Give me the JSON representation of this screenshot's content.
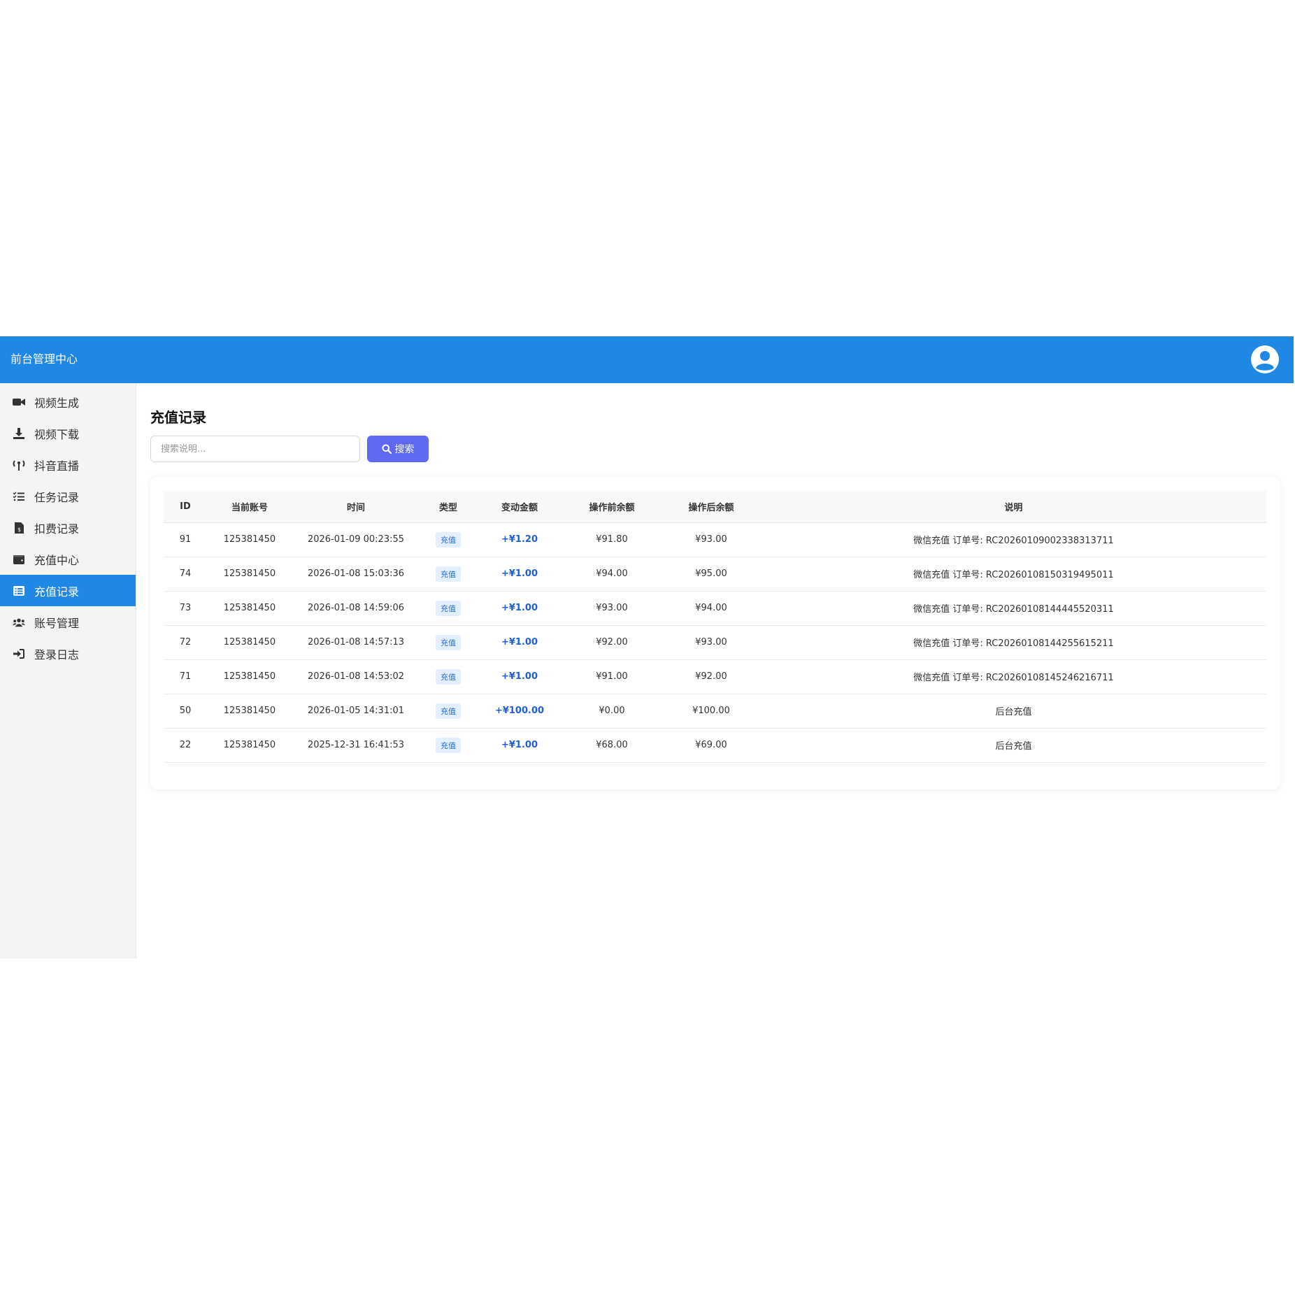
{
  "header": {
    "title": "前台管理中心",
    "avatar_icon": "user-circle-icon"
  },
  "sidebar": {
    "items": [
      {
        "label": "视频生成",
        "icon": "video-camera-icon",
        "active": false
      },
      {
        "label": "视频下载",
        "icon": "download-icon",
        "active": false
      },
      {
        "label": "抖音直播",
        "icon": "broadcast-tower-icon",
        "active": false
      },
      {
        "label": "任务记录",
        "icon": "task-list-icon",
        "active": false
      },
      {
        "label": "扣费记录",
        "icon": "invoice-dollar-icon",
        "active": false
      },
      {
        "label": "充值中心",
        "icon": "wallet-icon",
        "active": false
      },
      {
        "label": "充值记录",
        "icon": "list-alt-icon",
        "active": true
      },
      {
        "label": "账号管理",
        "icon": "users-icon",
        "active": false
      },
      {
        "label": "登录日志",
        "icon": "sign-in-icon",
        "active": false
      }
    ]
  },
  "main": {
    "title": "充值记录",
    "search": {
      "placeholder": "搜索说明...",
      "value": "",
      "button_label": "搜索"
    },
    "table": {
      "columns": [
        "ID",
        "当前账号",
        "时间",
        "类型",
        "变动金额",
        "操作前余额",
        "操作后余额",
        "说明"
      ],
      "rows": [
        [
          "91",
          "125381450",
          "2026-01-09 00:23:55",
          "充值",
          "+¥1.20",
          "¥91.80",
          "¥93.00",
          "微信充值 订单号: RC20260109002338313711"
        ],
        [
          "74",
          "125381450",
          "2026-01-08 15:03:36",
          "充值",
          "+¥1.00",
          "¥94.00",
          "¥95.00",
          "微信充值 订单号: RC20260108150319495011"
        ],
        [
          "73",
          "125381450",
          "2026-01-08 14:59:06",
          "充值",
          "+¥1.00",
          "¥93.00",
          "¥94.00",
          "微信充值 订单号: RC20260108144445520311"
        ],
        [
          "72",
          "125381450",
          "2026-01-08 14:57:13",
          "充值",
          "+¥1.00",
          "¥92.00",
          "¥93.00",
          "微信充值 订单号: RC20260108144255615211"
        ],
        [
          "71",
          "125381450",
          "2026-01-08 14:53:02",
          "充值",
          "+¥1.00",
          "¥91.00",
          "¥92.00",
          "微信充值 订单号: RC20260108145246216711"
        ],
        [
          "50",
          "125381450",
          "2026-01-05 14:31:01",
          "充值",
          "+¥100.00",
          "¥0.00",
          "¥100.00",
          "后台充值"
        ],
        [
          "22",
          "125381450",
          "2025-12-31 16:41:53",
          "充值",
          "+¥1.00",
          "¥68.00",
          "¥69.00",
          "后台充值"
        ]
      ]
    }
  },
  "colors": {
    "header_bg": "#1f88e5",
    "sidebar_bg": "#f4f4f4",
    "active_item": "#1f88e5",
    "search_button": "#6069f2",
    "amount_text": "#1f5fd6",
    "badge_bg": "#e4efff"
  }
}
